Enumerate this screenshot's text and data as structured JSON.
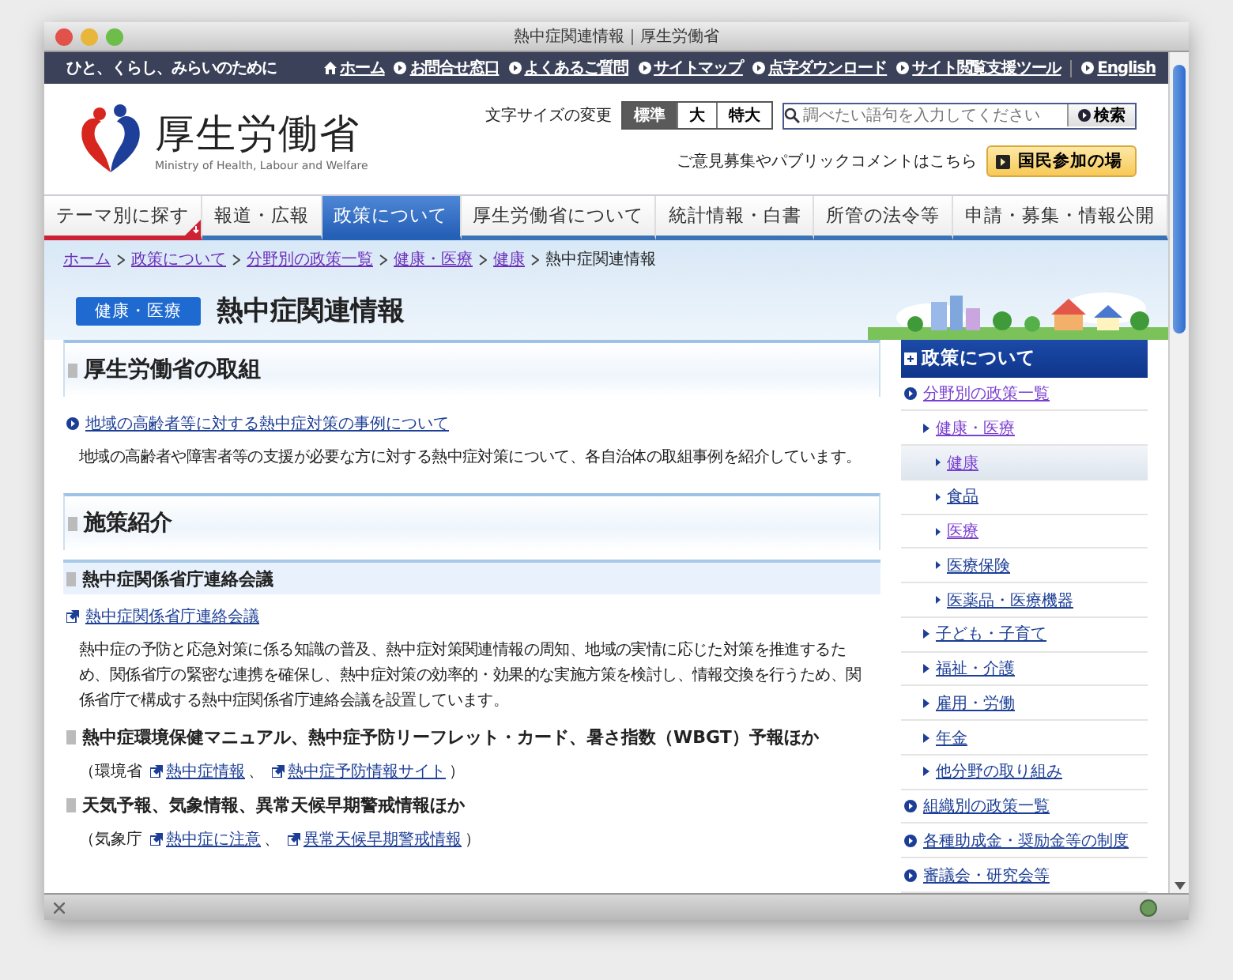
{
  "window": {
    "title": "熱中症関連情報｜厚生労働省"
  },
  "top_bar": {
    "tagline": "ひと、くらし、みらいのために",
    "links": [
      {
        "label": "ホーム",
        "kind": "home"
      },
      {
        "label": "お問合せ窓口",
        "kind": "arrow"
      },
      {
        "label": "よくあるご質問",
        "kind": "arrow"
      },
      {
        "label": "サイトマップ",
        "kind": "arrow"
      },
      {
        "label": "点字ダウンロード",
        "kind": "arrow"
      },
      {
        "label": "サイト閲覧支援ツール",
        "kind": "arrow"
      },
      {
        "label": "English",
        "kind": "arrow"
      }
    ]
  },
  "logo": {
    "name": "厚生労働省",
    "subtitle": "Ministry of Health, Labour and Welfare"
  },
  "text_size": {
    "label": "文字サイズの変更",
    "options": [
      {
        "label": "標準",
        "selected": true
      },
      {
        "label": "大",
        "selected": false
      },
      {
        "label": "特大",
        "selected": false
      }
    ]
  },
  "search": {
    "placeholder": "調べたい語句を入力してください",
    "button": "検索"
  },
  "public_comment": {
    "text": "ご意見募集やパブリックコメントはこちら",
    "button": "国民参加の場"
  },
  "nav_tabs": [
    {
      "label": "テーマ別に探す",
      "selected": false
    },
    {
      "label": "報道・広報",
      "selected": false
    },
    {
      "label": "政策について",
      "selected": true
    },
    {
      "label": "厚生労働省について",
      "selected": false
    },
    {
      "label": "統計情報・白書",
      "selected": false
    },
    {
      "label": "所管の法令等",
      "selected": false
    },
    {
      "label": "申請・募集・情報公開",
      "selected": false
    }
  ],
  "breadcrumb": {
    "links": [
      "ホーム",
      "政策について",
      "分野別の政策一覧",
      "健康・医療",
      "健康"
    ],
    "current": "熱中症関連情報"
  },
  "page": {
    "category": "健康・医療",
    "title": "熱中症関連情報"
  },
  "sections": [
    {
      "heading": "厚生労働省の取組",
      "blocks": [
        {
          "kind": "link",
          "text": "地域の高齢者等に対する熱中症対策の事例について"
        },
        {
          "kind": "paragraph",
          "text": "地域の高齢者や障害者等の支援が必要な方に対する熱中症対策について、各自治体の取組事例を紹介しています。"
        }
      ]
    },
    {
      "heading": "施策紹介",
      "blocks": [
        {
          "kind": "banded_subheading",
          "text": "熱中症関係省庁連絡会議"
        },
        {
          "kind": "external_link",
          "text": "熱中症関係省庁連絡会議"
        },
        {
          "kind": "paragraph",
          "text": "熱中症の予防と応急対策に係る知識の普及、熱中症対策関連情報の周知、地域の実情に応じた対策を推進するため、関係省庁の緊密な連携を確保し、熱中症対策の効率的・効果的な実施方策を検討し、情報交換を行うため、関係省庁で構成する熱中症関係省庁連絡会議を設置しています。"
        },
        {
          "kind": "subheading",
          "text": "熱中症環境保健マニュアル、熱中症予防リーフレット・カード、暑さ指数（WBGT）予報ほか"
        },
        {
          "kind": "source",
          "parts": [
            {
              "kind": "text",
              "text": "（環境省"
            },
            {
              "kind": "link",
              "text": "熱中症情報"
            },
            {
              "kind": "text",
              "text": "、"
            },
            {
              "kind": "link",
              "text": "熱中症予防情報サイト"
            },
            {
              "kind": "text",
              "text": "）"
            }
          ]
        },
        {
          "kind": "subheading",
          "text": "天気予報、気象情報、異常天候早期警戒情報ほか"
        },
        {
          "kind": "source",
          "parts": [
            {
              "kind": "text",
              "text": "（気象庁"
            },
            {
              "kind": "link",
              "text": "熱中症に注意"
            },
            {
              "kind": "text",
              "text": "、"
            },
            {
              "kind": "link",
              "text": "異常天候早期警戒情報"
            },
            {
              "kind": "text",
              "text": "）"
            }
          ]
        }
      ]
    }
  ],
  "sidebar": {
    "title": "政策について",
    "items": [
      {
        "label": "分野別の政策一覧",
        "visited": true,
        "selected": false,
        "children": [
          {
            "label": "健康・医療",
            "visited": true,
            "selected": false,
            "children": [
              {
                "label": "健康",
                "visited": true,
                "selected": true
              },
              {
                "label": "食品",
                "visited": false,
                "selected": false
              },
              {
                "label": "医療",
                "visited": true,
                "selected": false
              },
              {
                "label": "医療保険",
                "visited": false,
                "selected": false
              },
              {
                "label": "医薬品・医療機器",
                "visited": false,
                "selected": false
              }
            ]
          },
          {
            "label": "子ども・子育て",
            "visited": false,
            "selected": false
          },
          {
            "label": "福祉・介護",
            "visited": false,
            "selected": false
          },
          {
            "label": "雇用・労働",
            "visited": false,
            "selected": false
          },
          {
            "label": "年金",
            "visited": false,
            "selected": false
          },
          {
            "label": "他分野の取り組み",
            "visited": false,
            "selected": false
          }
        ]
      },
      {
        "label": "組織別の政策一覧",
        "visited": false,
        "selected": false
      },
      {
        "label": "各種助成金・奨励金等の制度",
        "visited": false,
        "selected": false
      },
      {
        "label": "審議会・研究会等",
        "visited": false,
        "selected": false
      }
    ]
  }
}
